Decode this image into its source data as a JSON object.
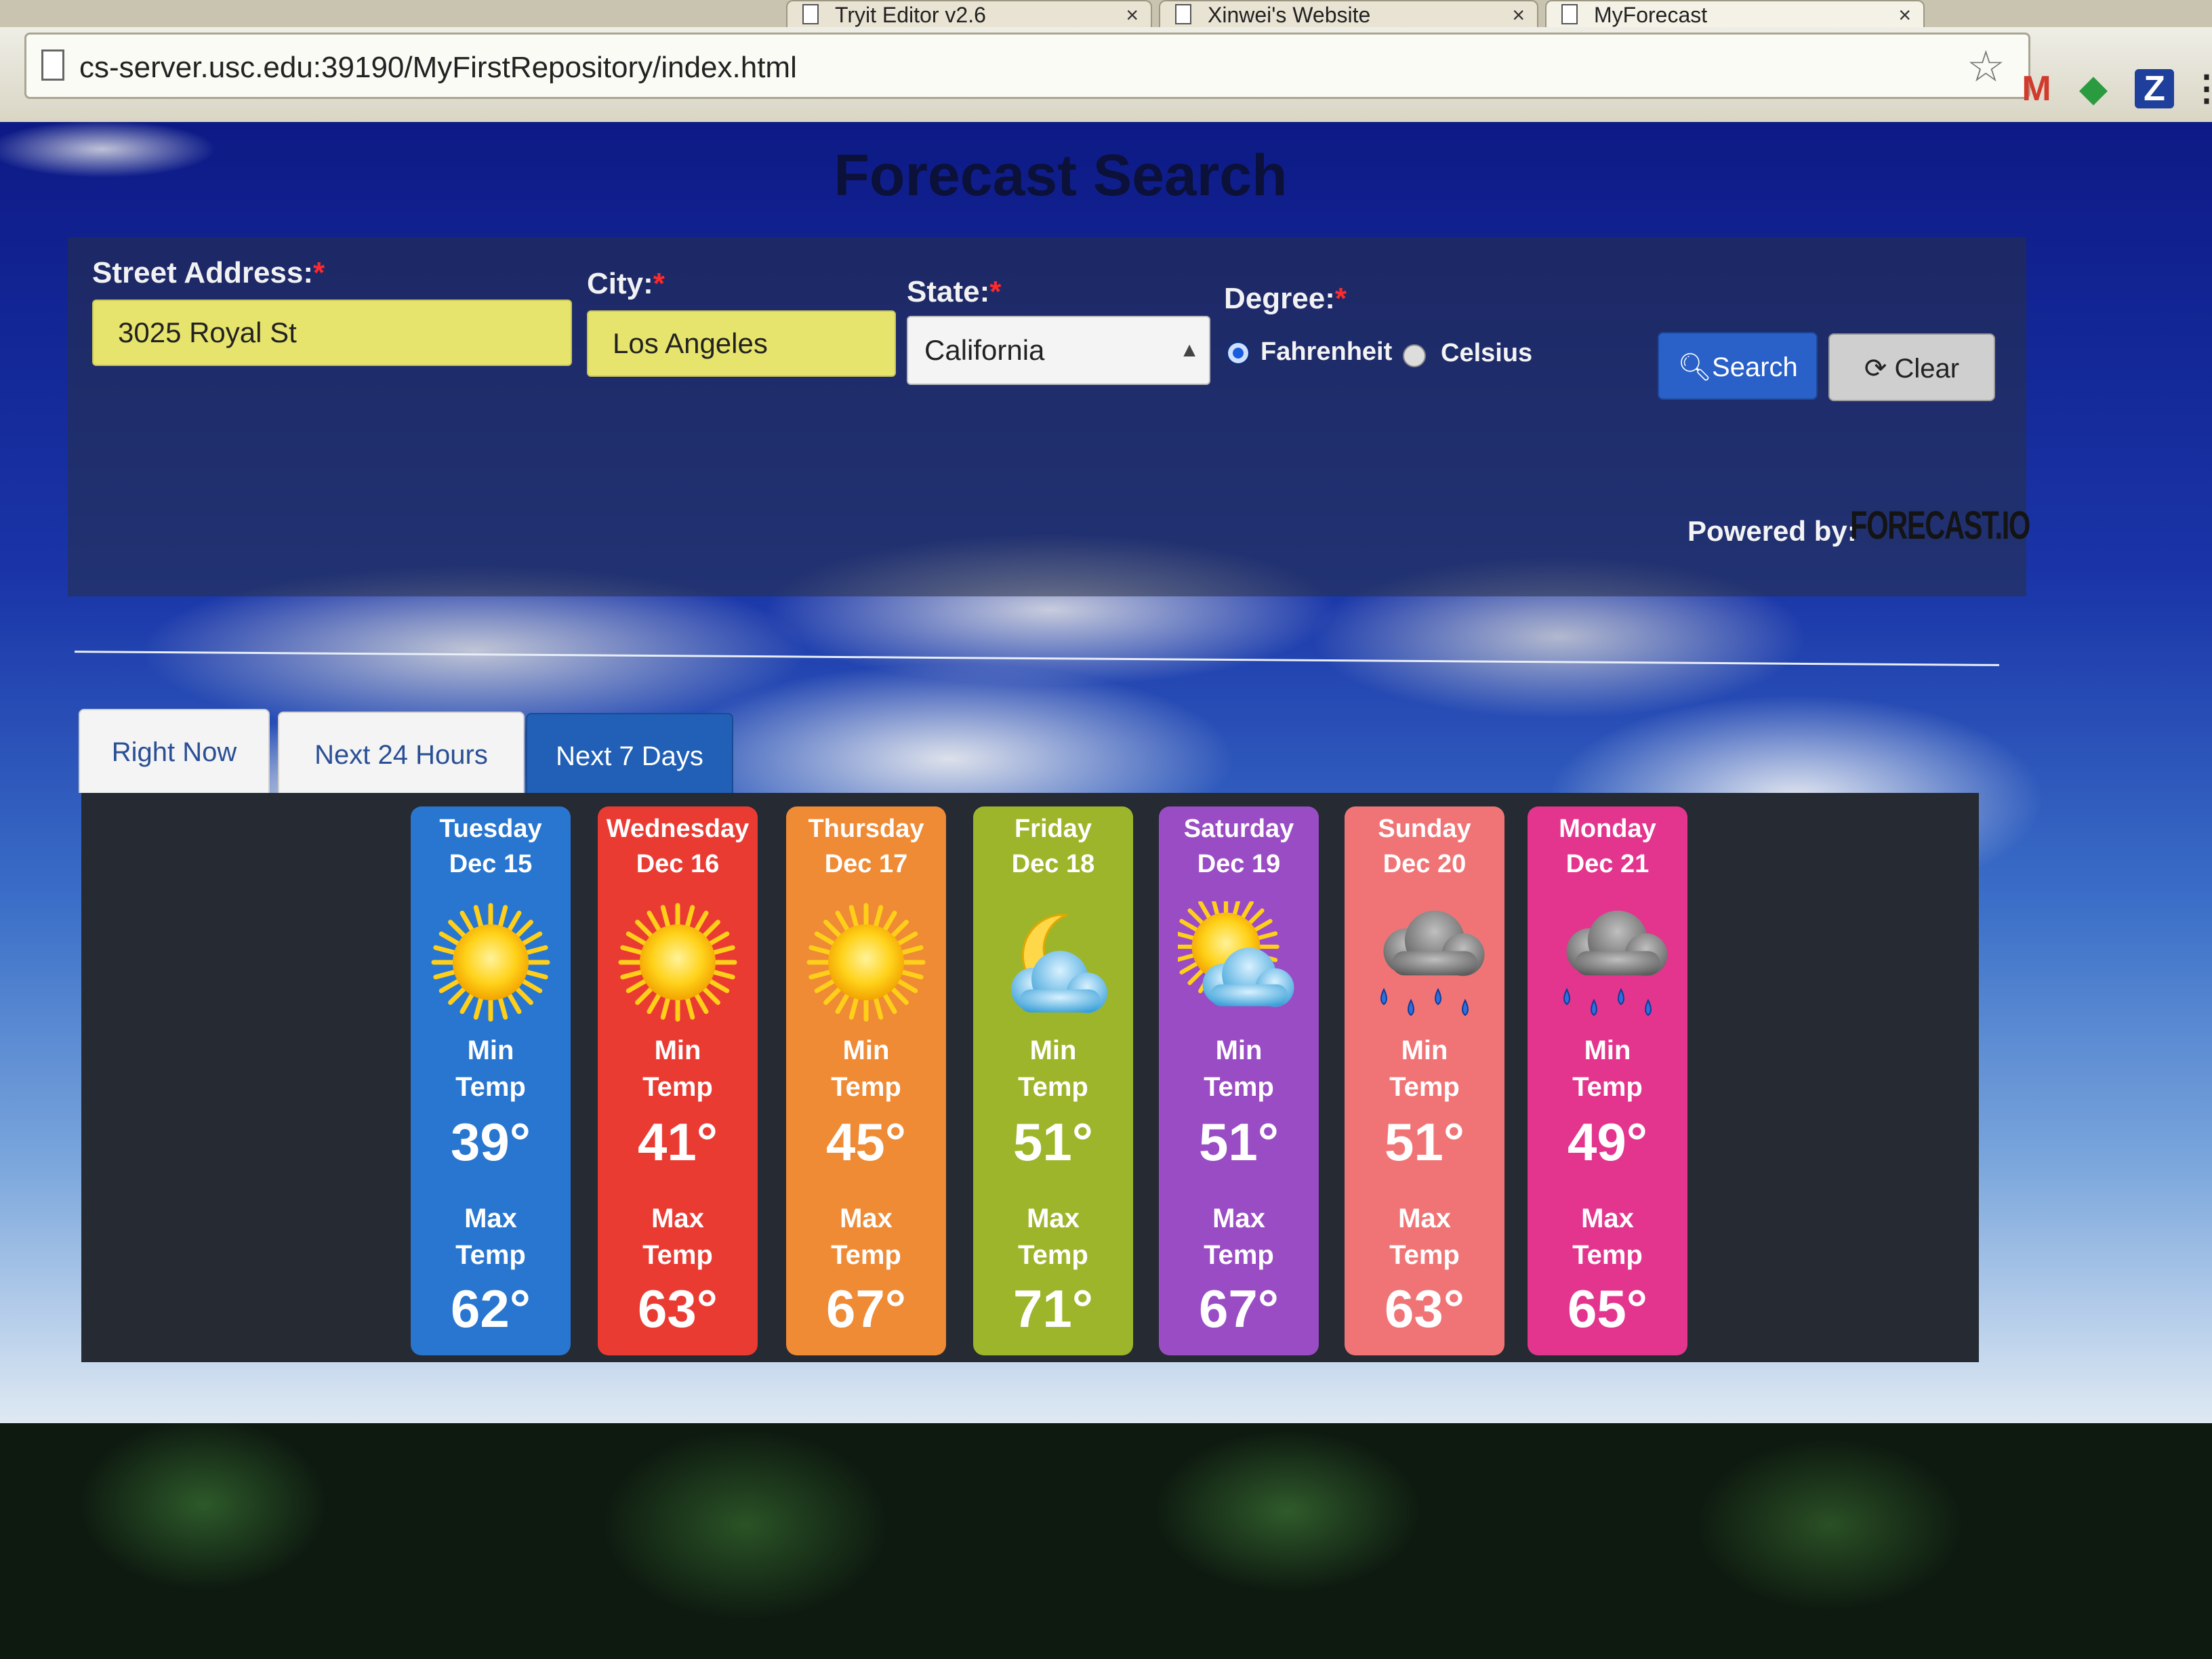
{
  "browser": {
    "tabs": [
      {
        "title": "Tryit Editor v2.6",
        "close": "×"
      },
      {
        "title": "Xinwei's Website",
        "close": "×"
      },
      {
        "title": "MyForecast",
        "close": "×"
      }
    ],
    "url": "cs-server.usc.edu:39190/MyFirstRepository/index.html",
    "extensions": {
      "gmail_badge": "M",
      "z_label": "Z"
    }
  },
  "page": {
    "title": "Forecast Search",
    "form": {
      "street_label": "Street Address:",
      "street_value": "3025 Royal St",
      "city_label": "City:",
      "city_value": "Los Angeles",
      "state_label": "State:",
      "state_value": "California",
      "degree_label": "Degree:",
      "required_mark": "*",
      "fahrenheit_label": "Fahrenheit",
      "celsius_label": "Celsius",
      "selected_degree": "Fahrenheit",
      "search_label": "Search",
      "clear_label": "Clear"
    },
    "powered_by": "Powered by:",
    "powered_logo": "FORECAST.IO",
    "tabs": [
      {
        "label": "Right Now",
        "active": false
      },
      {
        "label": "Next 24 Hours",
        "active": false
      },
      {
        "label": "Next 7 Days",
        "active": true
      }
    ],
    "days": [
      {
        "day": "Tuesday",
        "date": "Dec 15",
        "icon": "sun-icon",
        "min_label": "Min",
        "temp_label": "Temp",
        "min": "39°",
        "max_label": "Max",
        "max": "62°",
        "color": "#2876cf"
      },
      {
        "day": "Wednesday",
        "date": "Dec 16",
        "icon": "sun-icon",
        "min_label": "Min",
        "temp_label": "Temp",
        "min": "41°",
        "max_label": "Max",
        "max": "63°",
        "color": "#ea3b33"
      },
      {
        "day": "Thursday",
        "date": "Dec 17",
        "icon": "sun-icon",
        "min_label": "Min",
        "temp_label": "Temp",
        "min": "45°",
        "max_label": "Max",
        "max": "67°",
        "color": "#ef8a35"
      },
      {
        "day": "Friday",
        "date": "Dec 18",
        "icon": "moon-cloud-icon",
        "min_label": "Min",
        "temp_label": "Temp",
        "min": "51°",
        "max_label": "Max",
        "max": "71°",
        "color": "#9db52a"
      },
      {
        "day": "Saturday",
        "date": "Dec 19",
        "icon": "sun-cloud-icon",
        "min_label": "Min",
        "temp_label": "Temp",
        "min": "51°",
        "max_label": "Max",
        "max": "67°",
        "color": "#9a4cc4"
      },
      {
        "day": "Sunday",
        "date": "Dec 20",
        "icon": "rain-cloud-icon",
        "min_label": "Min",
        "temp_label": "Temp",
        "min": "51°",
        "max_label": "Max",
        "max": "63°",
        "color": "#f07476"
      },
      {
        "day": "Monday",
        "date": "Dec 21",
        "icon": "rain-cloud-icon",
        "min_label": "Min",
        "temp_label": "Temp",
        "min": "49°",
        "max_label": "Max",
        "max": "65°",
        "color": "#e3358e"
      }
    ]
  }
}
